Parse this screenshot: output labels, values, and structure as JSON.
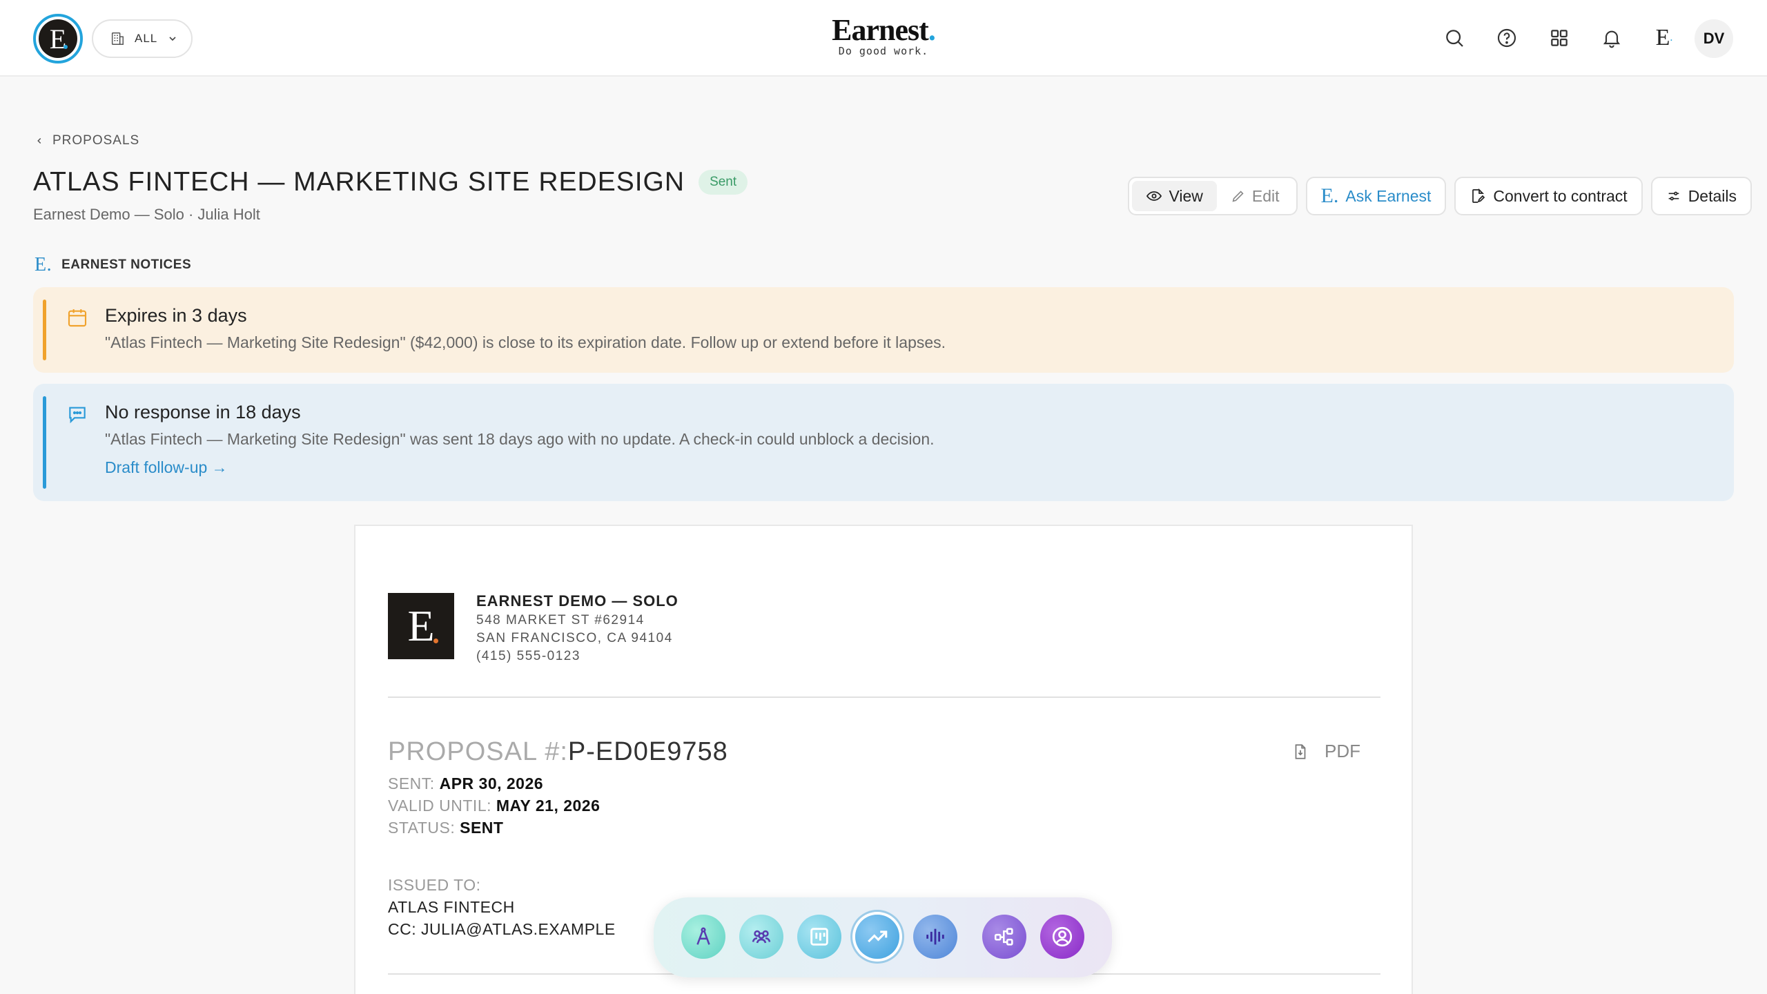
{
  "header": {
    "scope_label": "ALL",
    "brand_name": "Earnest",
    "brand_tagline": "Do good work.",
    "user_initials": "DV",
    "icons": [
      "search-icon",
      "help-icon",
      "apps-grid-icon",
      "bell-icon",
      "earnest-e-icon"
    ]
  },
  "breadcrumb": {
    "label": "PROPOSALS"
  },
  "page": {
    "title": "ATLAS FINTECH — MARKETING SITE REDESIGN",
    "status": "Sent",
    "subtitle": "Earnest Demo — Solo · Julia Holt"
  },
  "actions": {
    "view_label": "View",
    "edit_label": "Edit",
    "ask_label": "Ask Earnest",
    "convert_label": "Convert to contract",
    "details_label": "Details"
  },
  "notices": {
    "section_label": "EARNEST NOTICES",
    "items": [
      {
        "title": "Expires in 3 days",
        "text": "\"Atlas Fintech — Marketing Site Redesign\" ($42,000) is close to its expiration date. Follow up or extend before it lapses.",
        "icon": "calendar-icon"
      },
      {
        "title": "No response in 18 days",
        "text": "\"Atlas Fintech — Marketing Site Redesign\" was sent 18 days ago with no update. A check-in could unblock a decision.",
        "link": "Draft follow-up →",
        "icon": "chat-icon"
      }
    ]
  },
  "document": {
    "company_name": "EARNEST DEMO — SOLO",
    "address_1": "548 MARKET ST #62914",
    "address_2": "SAN FRANCISCO, CA 94104",
    "phone": "(415) 555-0123",
    "proposal_label": "PROPOSAL #:",
    "proposal_number": "P-ED0E9758",
    "pdf_label": "PDF",
    "sent_label": "SENT:",
    "sent_value": "APR 30, 2026",
    "valid_label": "VALID UNTIL:",
    "valid_value": "MAY 21, 2026",
    "status_label": "STATUS:",
    "status_value": "SENT",
    "issued_label": "ISSUED TO:",
    "issued_to": "ATLAS FINTECH",
    "cc": "CC: JULIA@ATLAS.EXAMPLE"
  },
  "dock": {
    "items": [
      {
        "icon": "compass-icon",
        "color": "#5fd2c3"
      },
      {
        "icon": "team-icon",
        "color": "#6ccfd6"
      },
      {
        "icon": "board-icon",
        "color": "#5cc3dc"
      },
      {
        "icon": "trend-up-icon",
        "color": "#3fa2df",
        "selected": true
      },
      {
        "icon": "audio-wave-icon",
        "color": "#4e86d8"
      },
      {
        "icon": "workflow-icon",
        "color": "#7a4fd2"
      },
      {
        "icon": "user-circle-icon",
        "color": "#8a2bc8"
      }
    ]
  }
}
